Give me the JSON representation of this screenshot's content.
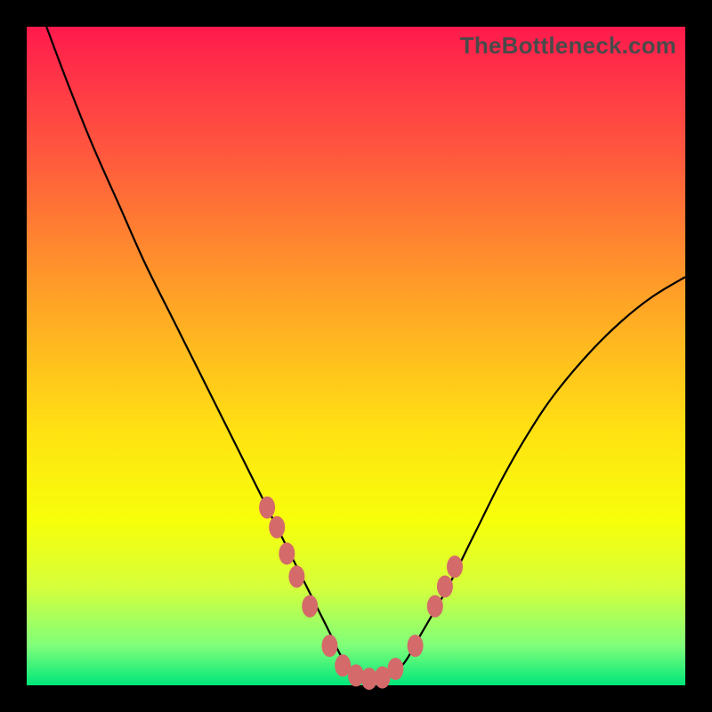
{
  "watermark": "TheBottleneck.com",
  "chart_data": {
    "type": "line",
    "title": "",
    "xlabel": "",
    "ylabel": "",
    "xlim": [
      0,
      100
    ],
    "ylim": [
      0,
      100
    ],
    "grid": false,
    "legend": false,
    "series": [
      {
        "name": "curve",
        "x": [
          3,
          6,
          10,
          14,
          18,
          22,
          26,
          30,
          34,
          37,
          40,
          43,
          46,
          48,
          50,
          52,
          54,
          57,
          60,
          64,
          68,
          72,
          76,
          80,
          85,
          90,
          95,
          100
        ],
        "y": [
          100,
          92,
          82,
          73,
          64,
          56,
          48,
          40,
          32,
          26,
          20,
          14,
          8,
          4,
          2,
          1,
          1,
          3,
          8,
          15,
          23,
          31,
          38,
          44,
          50,
          55,
          59,
          62
        ]
      }
    ],
    "markers": {
      "name": "highlight-points",
      "x": [
        36.5,
        38,
        39.5,
        41,
        43,
        46,
        48,
        50,
        52,
        54,
        56,
        59,
        62,
        63.5,
        65
      ],
      "y": [
        27,
        24,
        20,
        16.5,
        12,
        6,
        3,
        1.5,
        1,
        1.2,
        2.5,
        6,
        12,
        15,
        18
      ]
    },
    "colors": {
      "gradient_top": "#ff1a4d",
      "gradient_mid": "#ffe312",
      "gradient_bottom": "#00e67a",
      "curve": "#000000",
      "markers": "#d46a6a",
      "frame": "#000000"
    }
  }
}
